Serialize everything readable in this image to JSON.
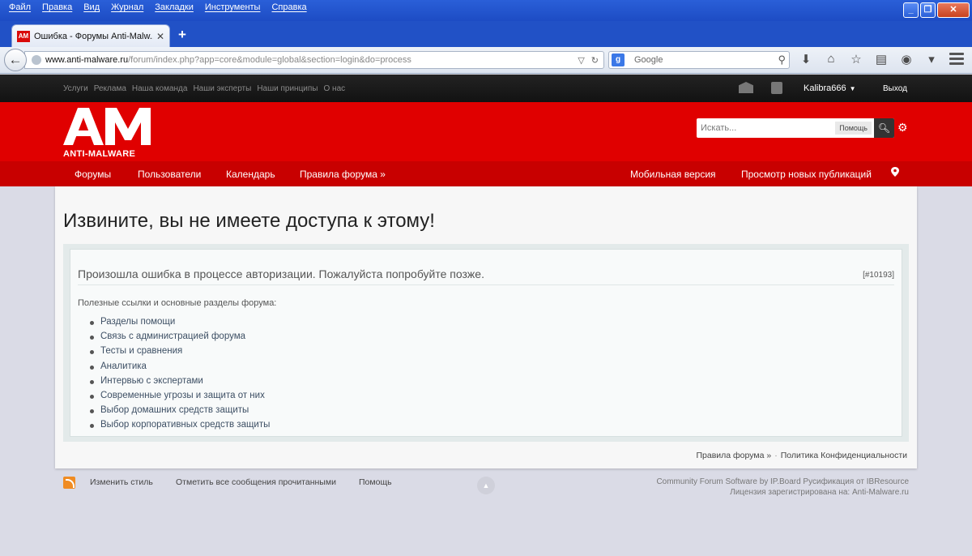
{
  "browser": {
    "menu": [
      "Файл",
      "Правка",
      "Вид",
      "Журнал",
      "Закладки",
      "Инструменты",
      "Справка"
    ],
    "tab_title": "Ошибка - Форумы Anti-Malw...",
    "favicon_text": "AM",
    "url_host": "www.anti-malware.ru",
    "url_path": "/forum/index.php?app=core&module=global&section=login&do=process",
    "search_placeholder": "Google",
    "search_engine_badge": "g"
  },
  "userbar": {
    "links": [
      "Услуги",
      "Реклама",
      "Наша команда",
      "Наши эксперты",
      "Наши принципы",
      "О нас"
    ],
    "username": "Kalibra666",
    "logout": "Выход"
  },
  "brand": {
    "logo_text": "ANTI-MALWARE",
    "logo_letters": "AM",
    "search_placeholder": "Искать...",
    "help_button": "Помощь"
  },
  "mainnav": {
    "items": [
      "Форумы",
      "Пользователи",
      "Календарь",
      "Правила форума »"
    ],
    "right_items": [
      "Мобильная версия",
      "Просмотр новых публикаций"
    ]
  },
  "content": {
    "title": "Извините, вы не имеете доступа к этому!",
    "error_message": "Произошла ошибка в процессе авторизации. Пожалуйста попробуйте позже.",
    "error_code": "[#10193]",
    "links_intro": "Полезные ссылки и основные разделы форума:",
    "links": [
      "Разделы помощи",
      "Связь с администрацией форума",
      "Тесты и сравнения",
      "Аналитика",
      "Интервью с экспертами",
      "Современные угрозы и защита от них",
      "Выбор домашних средств защиты",
      "Выбор корпоративных средств защиты"
    ],
    "bottom_links": [
      "Правила форума »",
      "Политика Конфиденциальности"
    ],
    "bottom_separator": "·"
  },
  "footer": {
    "links": [
      "Изменить стиль",
      "Отметить все сообщения прочитанными",
      "Помощь"
    ],
    "credits_line1": "Community Forum Software by IP.Board Русификация от IBResource",
    "credits_line2": "Лицензия зарегистрирована на: Anti-Malware.ru"
  },
  "colors": {
    "brand_red": "#e00000",
    "nav_red": "#c80000",
    "userbar_dark": "#1a1a1a",
    "page_bg": "#dadbe6"
  }
}
